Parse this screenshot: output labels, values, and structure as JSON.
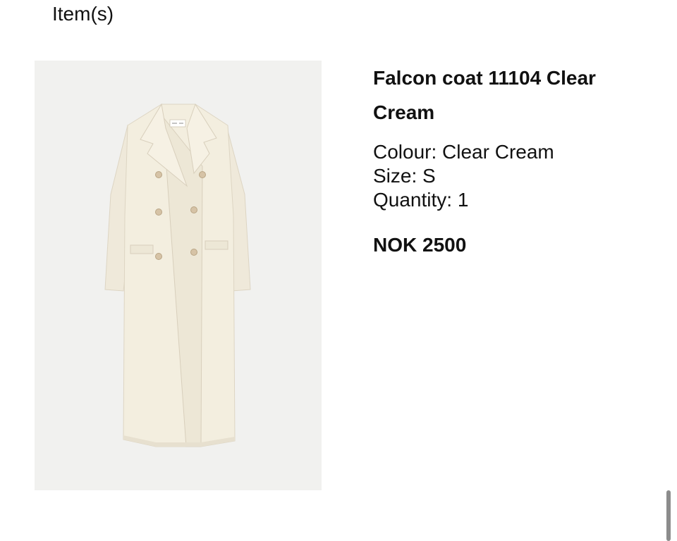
{
  "section": {
    "heading": "Item(s)"
  },
  "item": {
    "name": "Falcon coat 11104 Clear Cream",
    "colour_label": "Colour: Clear Cream",
    "size_label": "Size: S",
    "quantity_label": "Quantity: 1",
    "price": "NOK 2500",
    "image": {
      "subject": "cream double-breasted long coat",
      "background_color": "#f1f1ef",
      "coat_color": "#f3eedf"
    }
  },
  "colors": {
    "text": "#111111",
    "page_background": "#ffffff",
    "scrollbar": "#8c8c8c"
  }
}
